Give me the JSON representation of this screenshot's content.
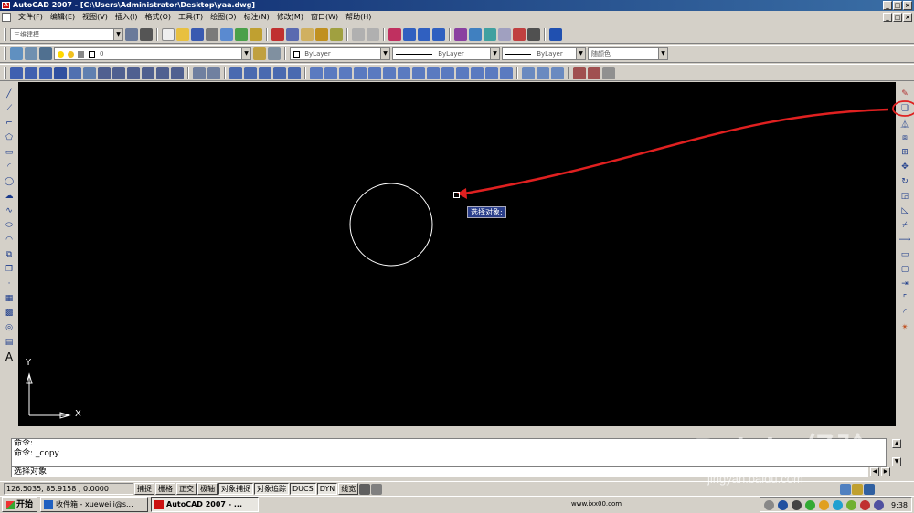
{
  "window": {
    "title": "AutoCAD 2007 - [C:\\Users\\Administrator\\Desktop\\yaa.dwg]"
  },
  "menu": {
    "items": [
      "文件(F)",
      "编辑(E)",
      "视图(V)",
      "插入(I)",
      "格式(O)",
      "工具(T)",
      "绘图(D)",
      "标注(N)",
      "修改(M)",
      "窗口(W)",
      "帮助(H)"
    ]
  },
  "toolbar": {
    "workspace": "三维建模",
    "layer": "0",
    "color": "ByLayer",
    "linetype": "ByLayer",
    "lineweight": "ByLayer",
    "plotstyle": "随颜色"
  },
  "canvas": {
    "tooltip": "选择对象:",
    "ucs_x": "X",
    "ucs_y": "Y"
  },
  "command": {
    "line1": "命令:",
    "line2": "命令: _copy",
    "prompt": "选择对象:"
  },
  "status": {
    "coords": "126.5035, 85.9158 , 0.0000",
    "buttons": [
      "捕捉",
      "栅格",
      "正交",
      "极轴",
      "对象捕捉",
      "对象追踪",
      "DUCS",
      "DYN",
      "线宽"
    ]
  },
  "taskbar": {
    "start": "开始",
    "tasks": [
      "收件箱 - xueweili@s...",
      "AutoCAD 2007 - ..."
    ],
    "tray_text": "www.ixx00.com",
    "clock": "9:38"
  },
  "watermark": {
    "brand": "Bai du 经验",
    "url": "jingyan.baidu.com"
  },
  "colors": {
    "canvas": "#000000",
    "annotation": "#e02020",
    "tooltip_bg": "#2a3e8a"
  }
}
